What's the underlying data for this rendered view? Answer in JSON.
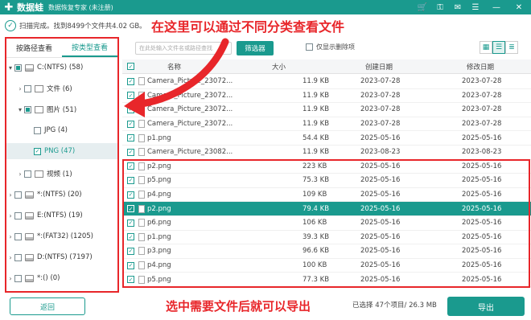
{
  "titlebar": {
    "app_name": "数据蛙",
    "app_sub": "数据恢复专家 (未注册)",
    "controls": [
      "cart-icon",
      "key-icon",
      "chat-icon",
      "menu-icon",
      "minimize-icon",
      "close-icon"
    ]
  },
  "status": {
    "text": "扫描完成。找到8499个文件共4.02 GB。"
  },
  "annotations": {
    "top": "在这里可以通过不同分类查看文件",
    "bottom": "选中需要文件后就可以导出"
  },
  "left_tabs": [
    {
      "label": "按路径查看"
    },
    {
      "label": "按类型查看"
    }
  ],
  "tree": [
    {
      "label": "C:(NTFS) (58)",
      "state": "partial",
      "expanded": true
    },
    {
      "label": "文件 (6)",
      "state": "none",
      "expanded": false
    },
    {
      "label": "图片 (51)",
      "state": "partial",
      "expanded": true
    },
    {
      "label": "JPG (4)",
      "state": "none"
    },
    {
      "label": "PNG (47)",
      "state": "checked"
    },
    {
      "label": "视频 (1)",
      "state": "none",
      "expanded": false
    },
    {
      "label": "*:(NTFS) (20)",
      "state": "none"
    },
    {
      "label": "E:(NTFS) (19)",
      "state": "none"
    },
    {
      "label": "*:(FAT32) (1205)",
      "state": "none"
    },
    {
      "label": "D:(NTFS) (7197)",
      "state": "none"
    },
    {
      "label": "*:() (0)",
      "state": "none"
    }
  ],
  "toolbar": {
    "search_placeholder": "在此处输入文件名或路径查找",
    "filter_label": "筛选器",
    "deleted_only_label": "仅显示删除项"
  },
  "table": {
    "headers": {
      "name": "名称",
      "size": "大小",
      "created": "创建日期",
      "modified": "修改日期"
    },
    "rows": [
      {
        "name": "Camera_Picture_23072...",
        "size": "11.9 KB",
        "created": "2023-07-28",
        "modified": "2023-07-28"
      },
      {
        "name": "Camera_Picture_23072...",
        "size": "11.9 KB",
        "created": "2023-07-28",
        "modified": "2023-07-28"
      },
      {
        "name": "Camera_Picture_23072...",
        "size": "11.9 KB",
        "created": "2023-07-28",
        "modified": "2023-07-28"
      },
      {
        "name": "Camera_Picture_23072...",
        "size": "11.9 KB",
        "created": "2023-07-28",
        "modified": "2023-07-28"
      },
      {
        "name": "p1.png",
        "size": "54.4 KB",
        "created": "2025-05-16",
        "modified": "2025-05-16"
      },
      {
        "name": "Camera_Picture_23082...",
        "size": "11.9 KB",
        "created": "2023-08-23",
        "modified": "2023-08-23"
      },
      {
        "name": "p2.png",
        "size": "223 KB",
        "created": "2025-05-16",
        "modified": "2025-05-16"
      },
      {
        "name": "p5.png",
        "size": "75.3 KB",
        "created": "2025-05-16",
        "modified": "2025-05-16"
      },
      {
        "name": "p4.png",
        "size": "109 KB",
        "created": "2025-05-16",
        "modified": "2025-05-16"
      },
      {
        "name": "p2.png",
        "size": "79.4 KB",
        "created": "2025-05-16",
        "modified": "2025-05-16"
      },
      {
        "name": "p6.png",
        "size": "106 KB",
        "created": "2025-05-16",
        "modified": "2025-05-16"
      },
      {
        "name": "p1.png",
        "size": "39.3 KB",
        "created": "2025-05-16",
        "modified": "2025-05-16"
      },
      {
        "name": "p3.png",
        "size": "96.6 KB",
        "created": "2025-05-16",
        "modified": "2025-05-16"
      },
      {
        "name": "p4.png",
        "size": "100 KB",
        "created": "2025-05-16",
        "modified": "2025-05-16"
      },
      {
        "name": "p5.png",
        "size": "77.3 KB",
        "created": "2025-05-16",
        "modified": "2025-05-16"
      }
    ],
    "highlighted_index": 9
  },
  "footer": {
    "back_label": "返回",
    "summary": "已选择 47个项目/ 26.3 MB",
    "export_label": "导出"
  },
  "colors": {
    "accent": "#1a9a8e",
    "annotation": "#e8262a"
  }
}
